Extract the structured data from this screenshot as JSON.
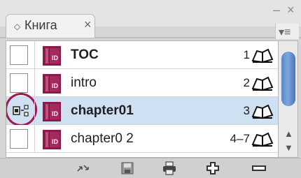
{
  "panel": {
    "tab_title": "Книга",
    "tab_close": "×",
    "tab_icon": "◇",
    "minimize": "–",
    "close_window": "×",
    "menu": "▾≡"
  },
  "documents": [
    {
      "name": "TOC",
      "pages": "1",
      "selected": false
    },
    {
      "name": "intro",
      "pages": "2",
      "selected": false
    },
    {
      "name": "chapter01",
      "pages": "3",
      "selected": true,
      "style_source": true
    },
    {
      "name": "chapter0 2",
      "pages": "4–7",
      "selected": false
    }
  ],
  "doc_icon_label": "ID",
  "scroll": {
    "up": "▲",
    "down": "▼"
  },
  "footer_buttons": [
    "synchronize-icon",
    "save-book-icon",
    "print-book-icon",
    "add-document-icon",
    "remove-document-icon"
  ],
  "colors": {
    "selected_row": "#cfe0f3",
    "doc_icon": "#8b1a4a",
    "focus_ring": "#9a1a4b",
    "scroll_thumb": "#5a86c5"
  }
}
